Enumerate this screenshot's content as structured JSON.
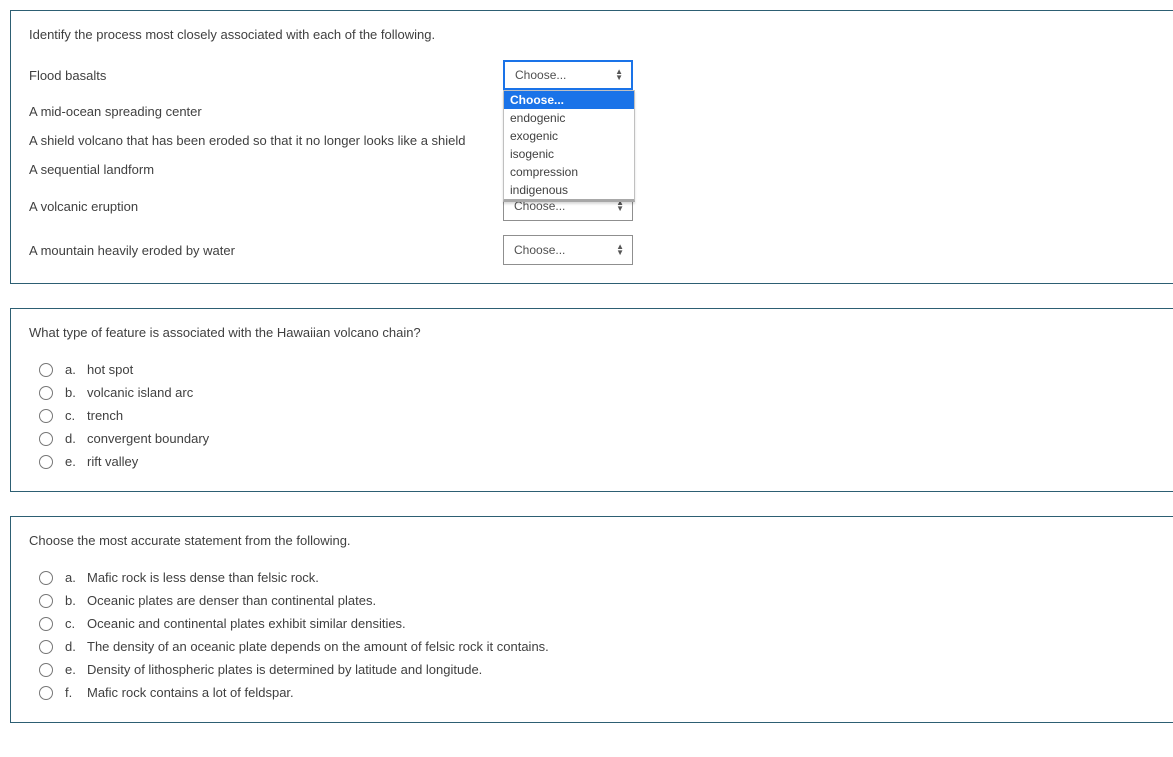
{
  "q1": {
    "prompt": "Identify the process most closely associated with each of the following.",
    "items": [
      "Flood basalts",
      "A mid-ocean spreading center",
      "A shield volcano that has been eroded so that it no longer looks like a shield",
      "A sequential landform",
      "A volcanic eruption",
      "A mountain heavily eroded by water"
    ],
    "placeholder": "Choose...",
    "options": [
      "Choose...",
      "endogenic",
      "exogenic",
      "isogenic",
      "compression",
      "indigenous"
    ]
  },
  "q2": {
    "prompt": "What type of feature is associated with the Hawaiian volcano chain?",
    "choices": [
      {
        "letter": "a.",
        "text": "hot spot"
      },
      {
        "letter": "b.",
        "text": "volcanic island arc"
      },
      {
        "letter": "c.",
        "text": "trench"
      },
      {
        "letter": "d.",
        "text": "convergent boundary"
      },
      {
        "letter": "e.",
        "text": "rift valley"
      }
    ]
  },
  "q3": {
    "prompt": "Choose the most accurate statement from the following.",
    "choices": [
      {
        "letter": "a.",
        "text": "Mafic rock is less dense than felsic rock."
      },
      {
        "letter": "b.",
        "text": "Oceanic plates are denser than continental plates."
      },
      {
        "letter": "c.",
        "text": "Oceanic and continental plates exhibit similar densities."
      },
      {
        "letter": "d.",
        "text": "The density of an oceanic plate depends on the amount of felsic rock it contains."
      },
      {
        "letter": "e.",
        "text": "Density of lithospheric plates is determined by latitude and longitude."
      },
      {
        "letter": "f.",
        "text": "Mafic rock contains a lot of feldspar."
      }
    ]
  }
}
